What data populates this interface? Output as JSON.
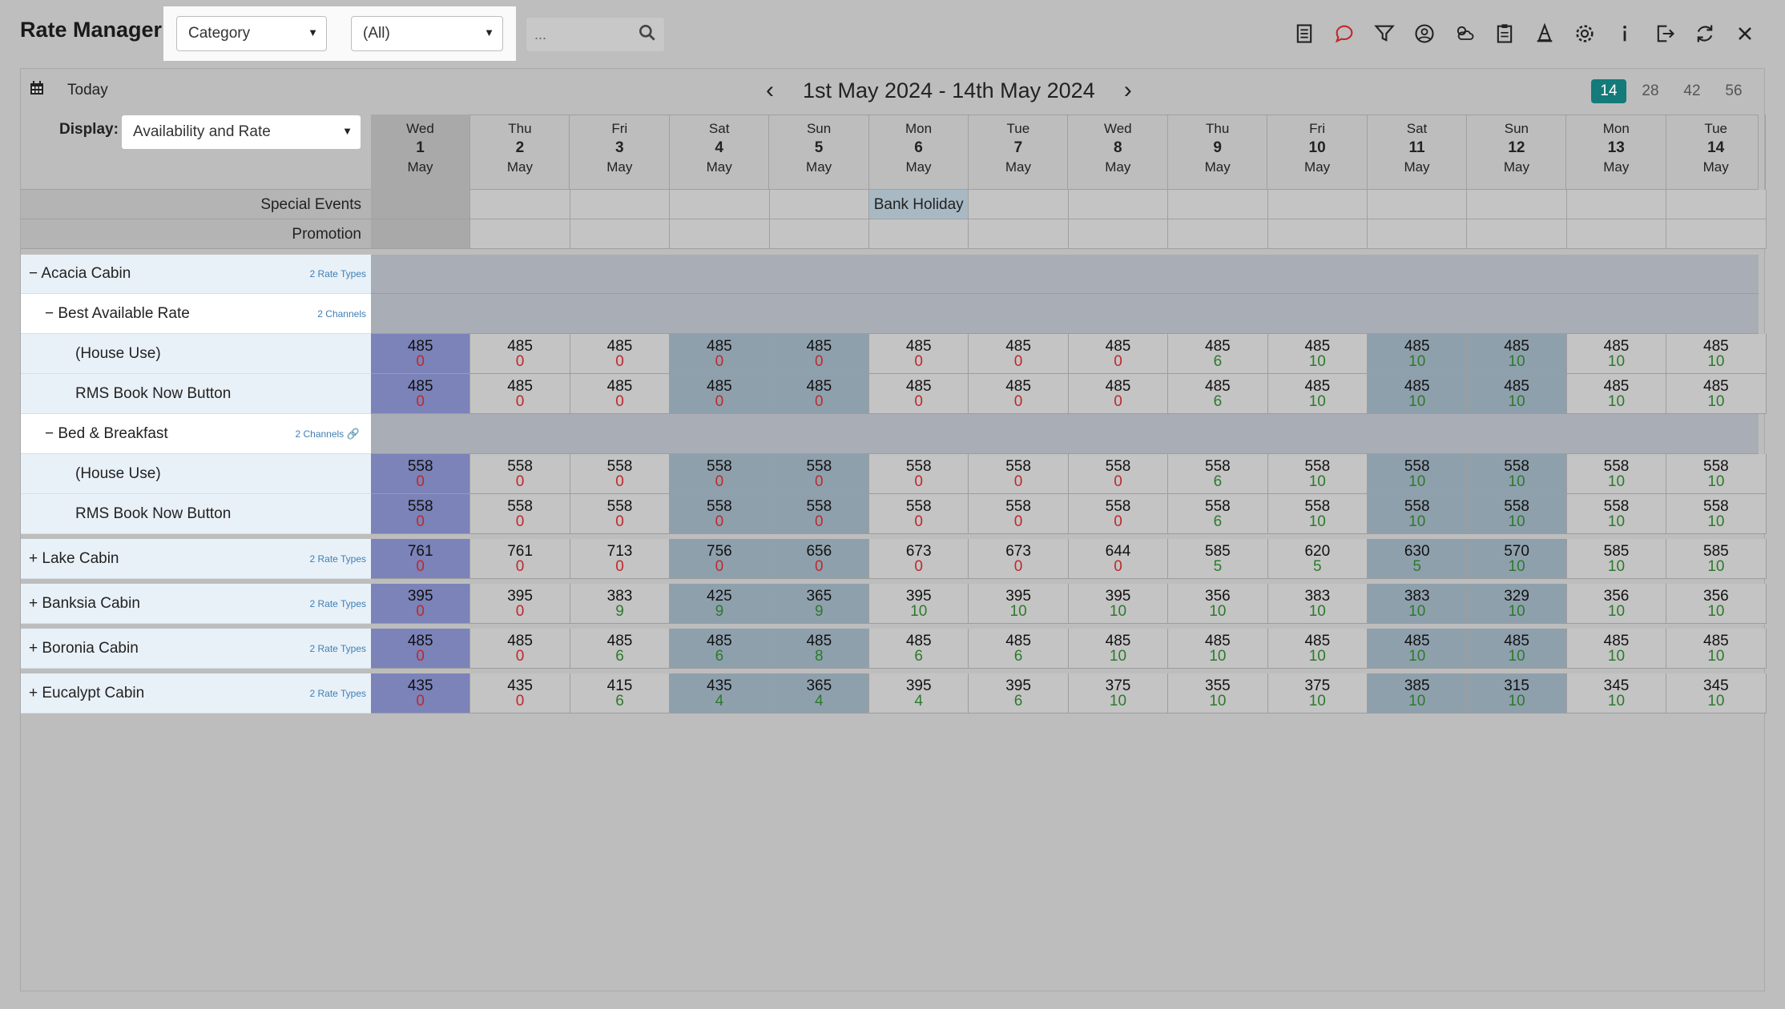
{
  "app": {
    "title": "Rate Manager"
  },
  "filters": {
    "category_select": "Category",
    "value_select": "(All)",
    "search_placeholder": "..."
  },
  "toolbar": [
    "list-icon",
    "chat-icon",
    "filter-icon",
    "user-money-icon",
    "weather-icon",
    "clipboard-icon",
    "cone-icon",
    "gear-icon",
    "info-icon",
    "logout-icon",
    "refresh-icon",
    "close-icon"
  ],
  "nav": {
    "today_label": "Today",
    "range": "1st May 2024 - 14th May 2024",
    "periods": [
      "14",
      "28",
      "42",
      "56"
    ],
    "active_period": "14"
  },
  "display": {
    "label": "Display:",
    "value": "Availability and Rate"
  },
  "days": [
    {
      "dow": "Wed",
      "num": "1",
      "mon": "May",
      "kind": "today"
    },
    {
      "dow": "Thu",
      "num": "2",
      "mon": "May",
      "kind": "norm"
    },
    {
      "dow": "Fri",
      "num": "3",
      "mon": "May",
      "kind": "norm"
    },
    {
      "dow": "Sat",
      "num": "4",
      "mon": "May",
      "kind": "weekend"
    },
    {
      "dow": "Sun",
      "num": "5",
      "mon": "May",
      "kind": "weekend"
    },
    {
      "dow": "Mon",
      "num": "6",
      "mon": "May",
      "kind": "norm"
    },
    {
      "dow": "Tue",
      "num": "7",
      "mon": "May",
      "kind": "norm"
    },
    {
      "dow": "Wed",
      "num": "8",
      "mon": "May",
      "kind": "norm"
    },
    {
      "dow": "Thu",
      "num": "9",
      "mon": "May",
      "kind": "norm"
    },
    {
      "dow": "Fri",
      "num": "10",
      "mon": "May",
      "kind": "norm"
    },
    {
      "dow": "Sat",
      "num": "11",
      "mon": "May",
      "kind": "weekend"
    },
    {
      "dow": "Sun",
      "num": "12",
      "mon": "May",
      "kind": "weekend"
    },
    {
      "dow": "Mon",
      "num": "13",
      "mon": "May",
      "kind": "norm"
    },
    {
      "dow": "Tue",
      "num": "14",
      "mon": "May",
      "kind": "norm"
    }
  ],
  "bands": {
    "special_events": {
      "label": "Special Events",
      "event_day_index": 5,
      "event": "Bank Holiday"
    },
    "promotion": {
      "label": "Promotion"
    }
  },
  "colors": {
    "active_period": "#147a7a",
    "today_col": "#7b83b8",
    "weekend_col": "#8fa0ad",
    "avail_zero": "#c0282a",
    "avail_positive": "#2b7a2b",
    "sub_link": "#3f7fb6"
  },
  "acacia": {
    "name": "Acacia Cabin",
    "sub": "2 Rate Types",
    "rate_types": [
      {
        "name": "Best Available Rate",
        "sub": "2 Channels",
        "channels": [
          {
            "name": "(House Use)",
            "rates": [
              "485",
              "485",
              "485",
              "485",
              "485",
              "485",
              "485",
              "485",
              "485",
              "485",
              "485",
              "485",
              "485",
              "485"
            ],
            "avail": [
              "0",
              "0",
              "0",
              "0",
              "0",
              "0",
              "0",
              "0",
              "6",
              "10",
              "10",
              "10",
              "10",
              "10"
            ]
          },
          {
            "name": "RMS Book Now Button",
            "rates": [
              "485",
              "485",
              "485",
              "485",
              "485",
              "485",
              "485",
              "485",
              "485",
              "485",
              "485",
              "485",
              "485",
              "485"
            ],
            "avail": [
              "0",
              "0",
              "0",
              "0",
              "0",
              "0",
              "0",
              "0",
              "6",
              "10",
              "10",
              "10",
              "10",
              "10"
            ]
          }
        ]
      },
      {
        "name": "Bed & Breakfast",
        "sub": "2 Channels",
        "channels": [
          {
            "name": "(House Use)",
            "rates": [
              "558",
              "558",
              "558",
              "558",
              "558",
              "558",
              "558",
              "558",
              "558",
              "558",
              "558",
              "558",
              "558",
              "558"
            ],
            "avail": [
              "0",
              "0",
              "0",
              "0",
              "0",
              "0",
              "0",
              "0",
              "6",
              "10",
              "10",
              "10",
              "10",
              "10"
            ]
          },
          {
            "name": "RMS Book Now Button",
            "rates": [
              "558",
              "558",
              "558",
              "558",
              "558",
              "558",
              "558",
              "558",
              "558",
              "558",
              "558",
              "558",
              "558",
              "558"
            ],
            "avail": [
              "0",
              "0",
              "0",
              "0",
              "0",
              "0",
              "0",
              "0",
              "6",
              "10",
              "10",
              "10",
              "10",
              "10"
            ]
          }
        ]
      }
    ]
  },
  "collapsed_categories": [
    {
      "name": "Lake Cabin",
      "sub": "2 Rate Types",
      "rates": [
        "761",
        "761",
        "713",
        "756",
        "656",
        "673",
        "673",
        "644",
        "585",
        "620",
        "630",
        "570",
        "585",
        "585"
      ],
      "avail": [
        "0",
        "0",
        "0",
        "0",
        "0",
        "0",
        "0",
        "0",
        "5",
        "5",
        "5",
        "10",
        "10",
        "10"
      ]
    },
    {
      "name": "Banksia Cabin",
      "sub": "2 Rate Types",
      "rates": [
        "395",
        "395",
        "383",
        "425",
        "365",
        "395",
        "395",
        "395",
        "356",
        "383",
        "383",
        "329",
        "356",
        "356"
      ],
      "avail": [
        "0",
        "0",
        "9",
        "9",
        "9",
        "10",
        "10",
        "10",
        "10",
        "10",
        "10",
        "10",
        "10",
        "10"
      ]
    },
    {
      "name": "Boronia Cabin",
      "sub": "2 Rate Types",
      "rates": [
        "485",
        "485",
        "485",
        "485",
        "485",
        "485",
        "485",
        "485",
        "485",
        "485",
        "485",
        "485",
        "485",
        "485"
      ],
      "avail": [
        "0",
        "0",
        "6",
        "6",
        "8",
        "6",
        "6",
        "10",
        "10",
        "10",
        "10",
        "10",
        "10",
        "10"
      ]
    },
    {
      "name": "Eucalypt Cabin",
      "sub": "2 Rate Types",
      "rates": [
        "435",
        "435",
        "415",
        "435",
        "365",
        "395",
        "395",
        "375",
        "355",
        "375",
        "385",
        "315",
        "345",
        "345"
      ],
      "avail": [
        "0",
        "0",
        "6",
        "4",
        "4",
        "4",
        "6",
        "10",
        "10",
        "10",
        "10",
        "10",
        "10",
        "10"
      ]
    }
  ]
}
